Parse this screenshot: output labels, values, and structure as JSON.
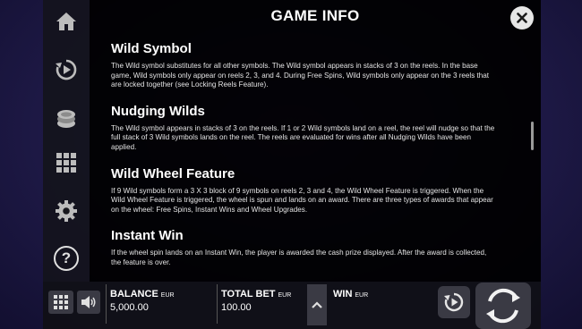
{
  "header": {
    "title": "GAME INFO"
  },
  "sidebar": {
    "items": [
      {
        "icon": "home-icon"
      },
      {
        "icon": "autoplay-icon"
      },
      {
        "icon": "coins-icon"
      },
      {
        "icon": "paytable-grid-icon"
      },
      {
        "icon": "settings-gear-icon"
      },
      {
        "icon": "help-icon",
        "label": "?"
      }
    ]
  },
  "sections": [
    {
      "heading": "Wild Symbol",
      "text": "The Wild symbol substitutes for all other symbols. The Wild symbol appears in stacks of 3 on the reels. In the base game, Wild symbols only appear on reels 2, 3, and 4. During Free Spins, Wild symbols only appear on the 3 reels that are locked together (see Locking Reels Feature)."
    },
    {
      "heading": "Nudging Wilds",
      "text": "The Wild symbol appears in stacks of 3 on the reels. If 1 or 2 Wild symbols land on a reel, the reel will nudge so that the full stack of 3 Wild symbols lands on the reel. The reels are evaluated for wins after all Nudging Wilds have been applied."
    },
    {
      "heading": "Wild Wheel Feature",
      "text": "If 9 Wild symbols form a 3 X 3 block of 9 symbols on reels 2, 3 and 4, the Wild Wheel Feature is triggered. When the Wild Wheel Feature is triggered, the wheel is spun and lands on an award. There are three types of awards that appear on the wheel: Free Spins, Instant Wins and Wheel Upgrades."
    },
    {
      "heading": "Instant Win",
      "text": "If the wheel spin lands on an Instant Win, the player is awarded the cash prize displayed. After the award is collected, the feature is over."
    }
  ],
  "footer": {
    "balance_label": "BALANCE",
    "balance_currency": "EUR",
    "balance_value": "5,000.00",
    "totalbet_label": "TOTAL BET",
    "totalbet_currency": "EUR",
    "totalbet_value": "100.00",
    "win_label": "WIN",
    "win_currency": "EUR"
  },
  "colors": {
    "panel": "#000000",
    "text": "#ffffff",
    "button": "#e6e6e6"
  }
}
